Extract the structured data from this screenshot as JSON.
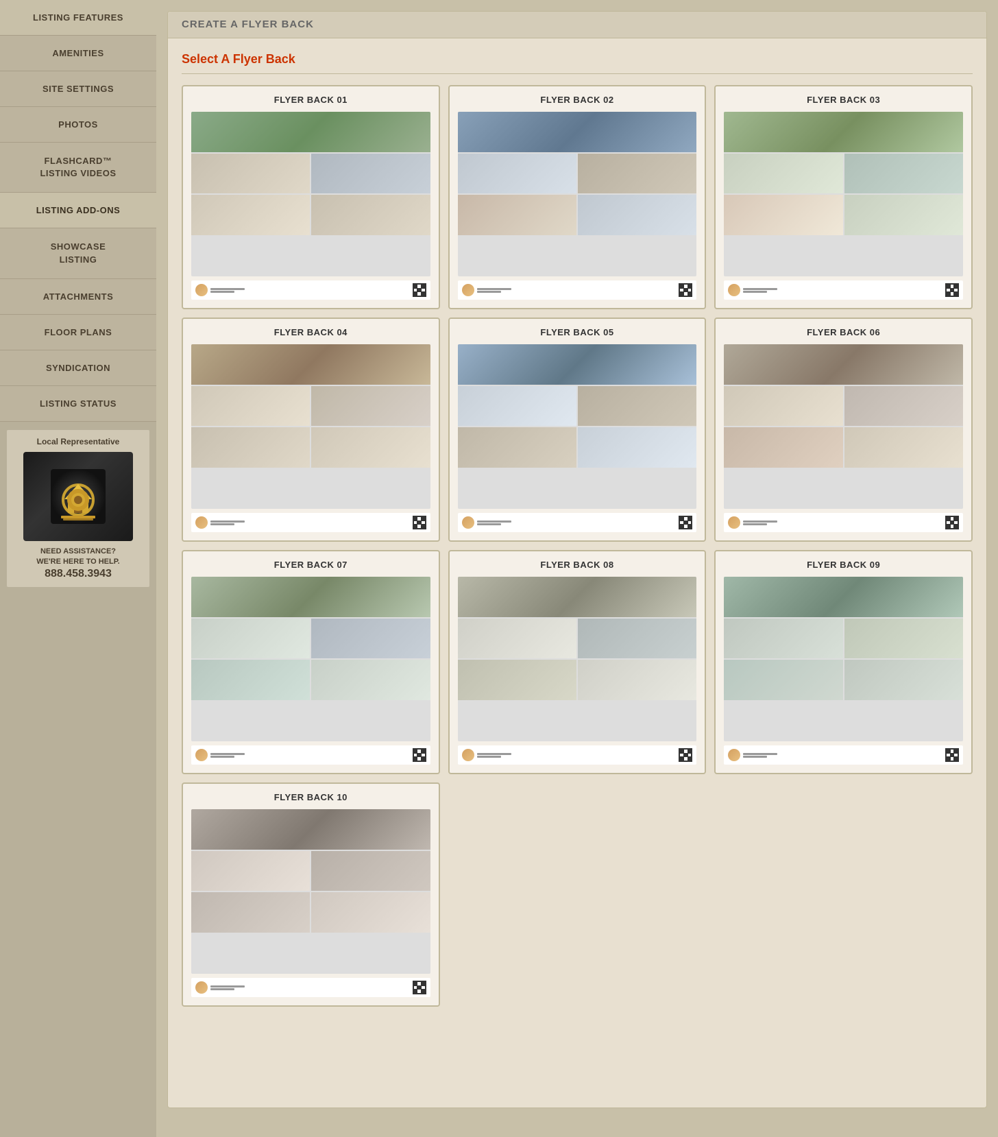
{
  "sidebar": {
    "items": [
      {
        "id": "listing-features",
        "label": "LISTING FEATURES",
        "active": false
      },
      {
        "id": "amenities",
        "label": "AMENITIES",
        "active": false
      },
      {
        "id": "site-settings",
        "label": "SITE SETTINGS",
        "active": false
      },
      {
        "id": "photos",
        "label": "PHOTOS",
        "active": false
      },
      {
        "id": "flashcard",
        "label": "FLASHCARD™\nLISTING VIDEOS",
        "active": false,
        "multiline": true,
        "line1": "FLASHCARD™",
        "line2": "LISTING VIDEOS"
      },
      {
        "id": "listing-addons",
        "label": "LISTING ADD-ONS",
        "active": true
      },
      {
        "id": "showcase-listing",
        "label": "SHOWCASE\nLISTING",
        "active": false,
        "multiline": true,
        "line1": "SHOWCASE",
        "line2": "LISTING"
      },
      {
        "id": "attachments",
        "label": "ATTACHMENTS",
        "active": false
      },
      {
        "id": "floor-plans",
        "label": "FLOOR PLANS",
        "active": false
      },
      {
        "id": "syndication",
        "label": "SYNDICATION",
        "active": false
      },
      {
        "id": "listing-status",
        "label": "LISTING STATUS",
        "active": false
      }
    ],
    "local_rep": {
      "title": "Local Representative",
      "need_assistance": "NEED ASSISTANCE?\nWE'RE HERE TO HELP.",
      "phone": "888.458.3943"
    }
  },
  "page": {
    "header_title": "CREATE A FLYER BACK",
    "section_title": "Select A Flyer Back",
    "flyers": [
      {
        "id": 1,
        "label": "FLYER BACK 01"
      },
      {
        "id": 2,
        "label": "FLYER BACK 02"
      },
      {
        "id": 3,
        "label": "FLYER BACK 03"
      },
      {
        "id": 4,
        "label": "FLYER BACK 04"
      },
      {
        "id": 5,
        "label": "FLYER BACK 05"
      },
      {
        "id": 6,
        "label": "FLYER BACK 06"
      },
      {
        "id": 7,
        "label": "FLYER BACK 07"
      },
      {
        "id": 8,
        "label": "FLYER BACK 08"
      },
      {
        "id": 9,
        "label": "FLYER BACK 09"
      },
      {
        "id": 10,
        "label": "FLYER BACK 10"
      }
    ]
  }
}
